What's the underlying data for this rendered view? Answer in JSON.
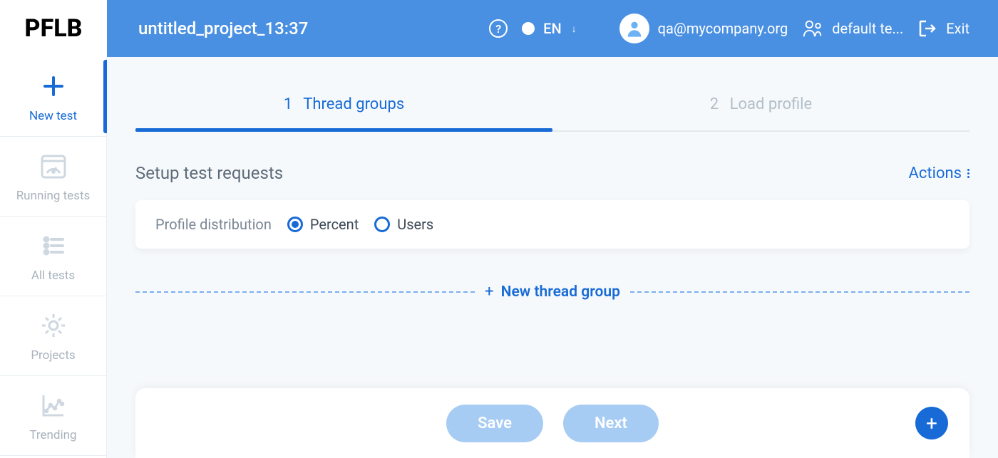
{
  "brand": "PFLB",
  "header": {
    "project_title": "untitled_project_13:37",
    "help_symbol": "?",
    "lang_code": "EN",
    "lang_caret": "↓",
    "user_email": "qa@mycompany.org",
    "team_name": "default te...",
    "exit_label": "Exit"
  },
  "sidebar": {
    "items": [
      {
        "id": "new-test",
        "label": "New test",
        "active": true
      },
      {
        "id": "running-tests",
        "label": "Running tests",
        "active": false
      },
      {
        "id": "all-tests",
        "label": "All tests",
        "active": false
      },
      {
        "id": "projects",
        "label": "Projects",
        "active": false
      },
      {
        "id": "trending",
        "label": "Trending",
        "active": false
      }
    ]
  },
  "steps": {
    "step1_num": "1",
    "step1_label": "Thread groups",
    "step2_num": "2",
    "step2_label": "Load profile"
  },
  "section": {
    "title": "Setup test requests",
    "actions_label": "Actions"
  },
  "distribution": {
    "label": "Profile distribution",
    "option_percent": "Percent",
    "option_users": "Users",
    "selected": "percent"
  },
  "new_group": {
    "plus": "+",
    "label": "New thread group"
  },
  "footer": {
    "save": "Save",
    "next": "Next",
    "fab": "+"
  }
}
